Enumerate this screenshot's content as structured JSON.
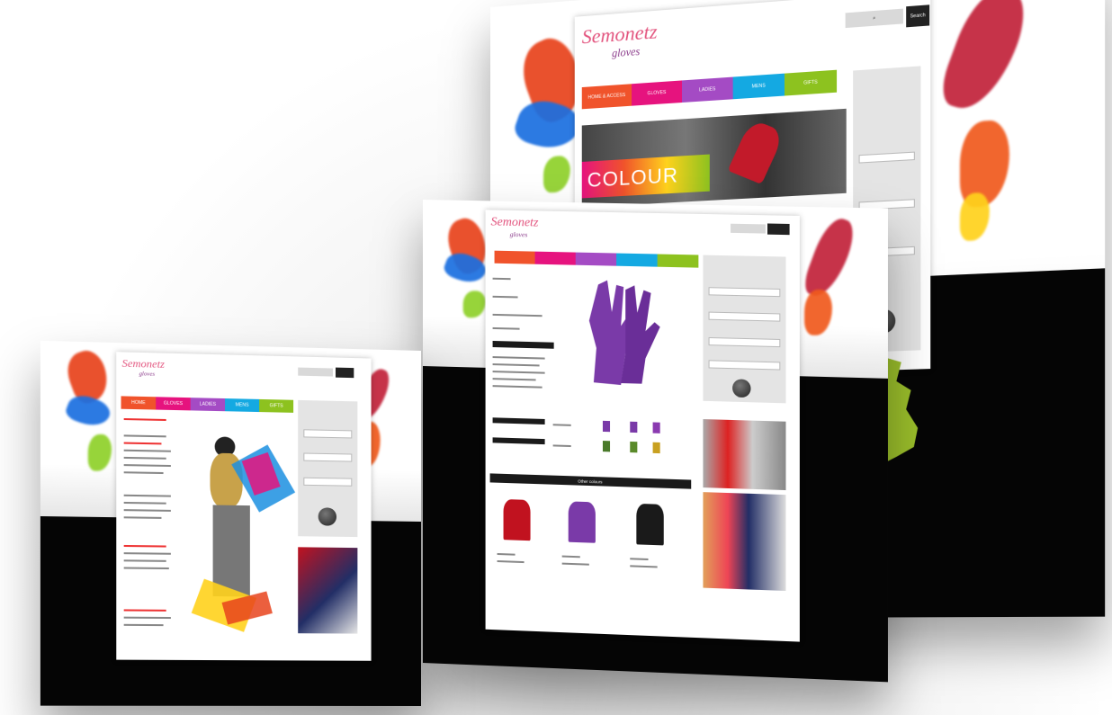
{
  "brand": {
    "logo_main": "Semonetz",
    "logo_sub": "gloves"
  },
  "colors": {
    "tab1": "#f0532b",
    "tab2": "#e6137e",
    "tab3": "#a44bc4",
    "tab4": "#14a9e2",
    "tab5": "#8dc21f",
    "accent_red": "#e3557f"
  },
  "back_page": {
    "hero_text": "COLOUR",
    "search_button": "Search",
    "nav_tabs": [
      "HOME & ACCESS",
      "GLOVES",
      "LADIES",
      "MENS",
      "GIFTS"
    ]
  },
  "product_page": {
    "section_bar": "Other colours"
  },
  "front_page": {
    "nav_tabs": [
      "HOME",
      "GLOVES",
      "LADIES",
      "MENS",
      "GIFTS"
    ]
  },
  "icons": [
    "search-icon",
    "glove-icon",
    "uk-map-icon",
    "go-button-icon"
  ]
}
